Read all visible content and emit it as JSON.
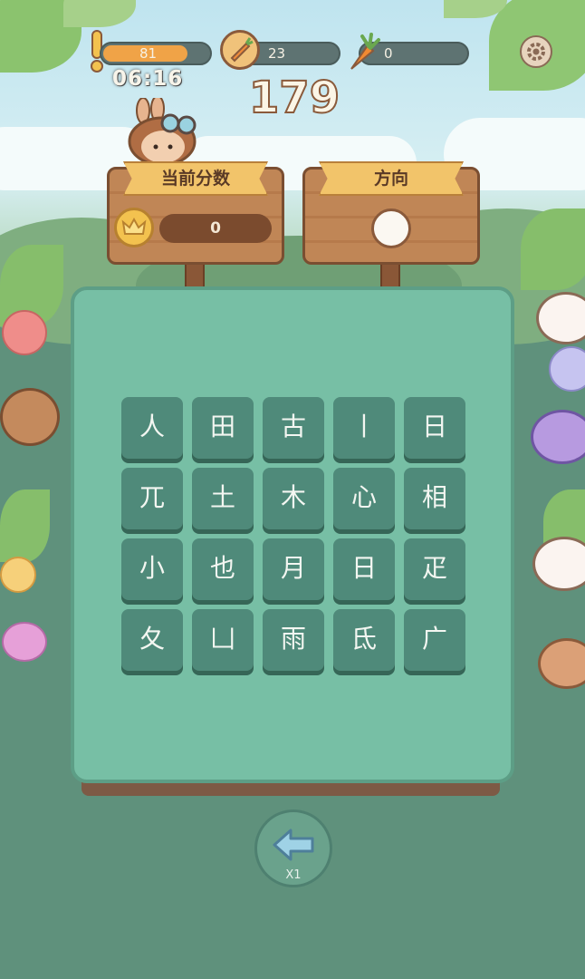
{
  "hud": {
    "energy_value": "81",
    "energy_level": 0.81,
    "carrot_coins": "23",
    "carrots": "0",
    "timer": "06:16",
    "score_big": "179"
  },
  "current_score": {
    "label": "当前分数",
    "value": "0"
  },
  "direction": {
    "label": "方向"
  },
  "grid": {
    "rows": [
      [
        "人",
        "田",
        "古",
        "丨",
        "日"
      ],
      [
        "兀",
        "土",
        "木",
        "心",
        "相"
      ],
      [
        "小",
        "也",
        "月",
        "日",
        "疋"
      ],
      [
        "夂",
        "凵",
        "雨",
        "氐",
        "广"
      ]
    ]
  },
  "back_button": {
    "count": "X1"
  },
  "colors": {
    "board": "#77bfa5",
    "tile": "#4f8a7a",
    "sign_wood": "#c08656",
    "ribbon": "#f2c46a",
    "energy_fill": "#f0a347"
  }
}
